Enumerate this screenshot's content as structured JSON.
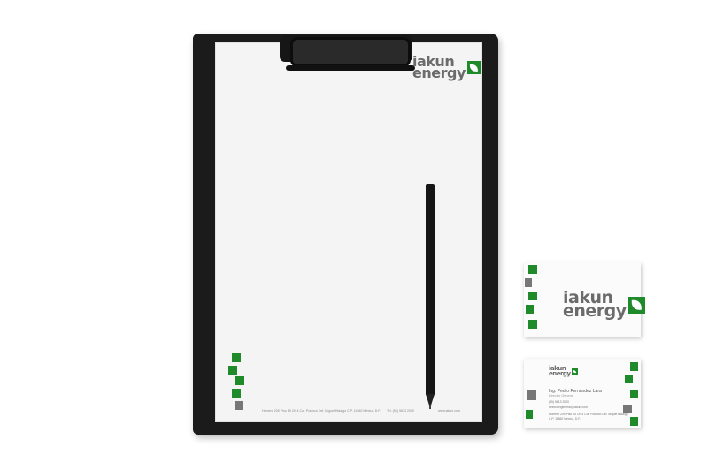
{
  "brand": {
    "line1": "iakun",
    "line2": "energy",
    "leaf_icon": "leaf-icon",
    "green": "#1e8a2a",
    "gray": "#777777"
  },
  "letterhead": {
    "address": "Homero 205 Piso 15 Of. 4 Col. Polanco Del. Miguel Hidalgo C.P. 11560 México, D.F.",
    "phone": "Tel. (55) 5613 2000",
    "web": "www.iakun.com"
  },
  "card_back": {
    "name": "Ing. Pedro Fernández Lara",
    "title": "Director General",
    "phone": "(55) 5613 2000",
    "email": "direcciongeneral@iakun.com",
    "address1": "Homero 205 Piso 15 Of. 4 Col. Polanco Del. Miguel Hidalgo",
    "address2": "C.P. 11560 México, D.F."
  }
}
